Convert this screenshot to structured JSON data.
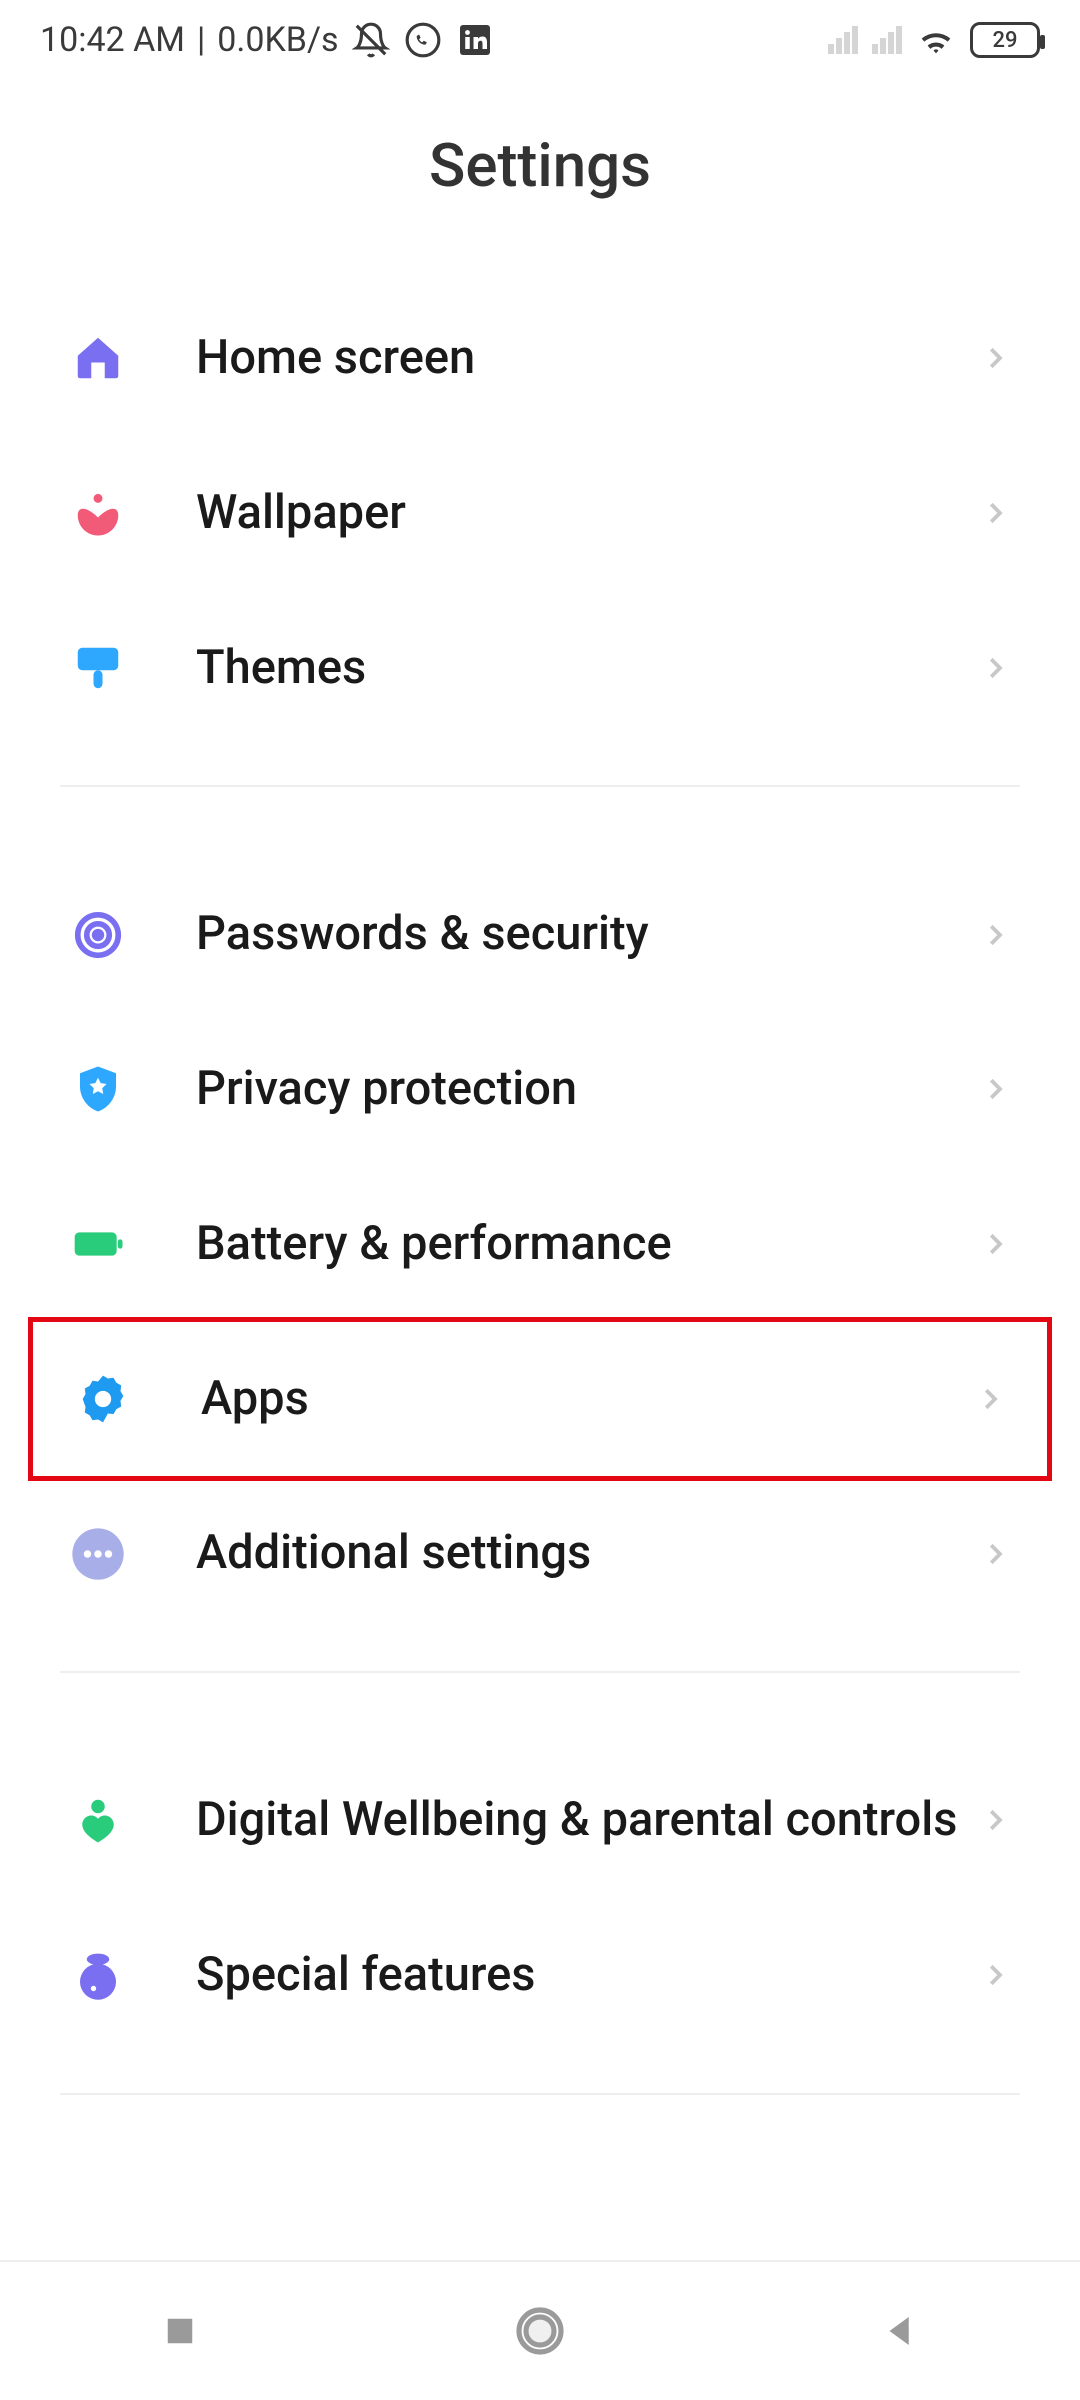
{
  "status": {
    "time": "10:42 AM",
    "netspeed": "0.0KB/s",
    "battery": "29"
  },
  "title": "Settings",
  "groups": [
    {
      "items": [
        {
          "key": "home-screen",
          "label": "Home screen",
          "icon": "home-icon",
          "color": "#7a6ff0"
        },
        {
          "key": "wallpaper",
          "label": "Wallpaper",
          "icon": "flower-icon",
          "color": "#f25b77"
        },
        {
          "key": "themes",
          "label": "Themes",
          "icon": "brush-icon",
          "color": "#2ea8ff"
        }
      ]
    },
    {
      "items": [
        {
          "key": "passwords-security",
          "label": "Passwords & security",
          "icon": "fingerprint-icon",
          "color": "#7a6ff0"
        },
        {
          "key": "privacy-protection",
          "label": "Privacy protection",
          "icon": "shield-icon",
          "color": "#2ea8ff"
        },
        {
          "key": "battery-performance",
          "label": "Battery & performance",
          "icon": "battery-icon",
          "color": "#29cc7a"
        },
        {
          "key": "apps",
          "label": "Apps",
          "icon": "gear-icon",
          "color": "#1e9bf0",
          "highlight": true
        },
        {
          "key": "additional-settings",
          "label": "Additional settings",
          "icon": "dots-icon",
          "color": "#a7aee8"
        }
      ]
    },
    {
      "items": [
        {
          "key": "digital-wellbeing",
          "label": "Digital Wellbeing & parental controls",
          "icon": "heart-person-icon",
          "color": "#29cc7a"
        },
        {
          "key": "special-features",
          "label": "Special features",
          "icon": "flask-icon",
          "color": "#7a6ff0"
        }
      ]
    }
  ]
}
